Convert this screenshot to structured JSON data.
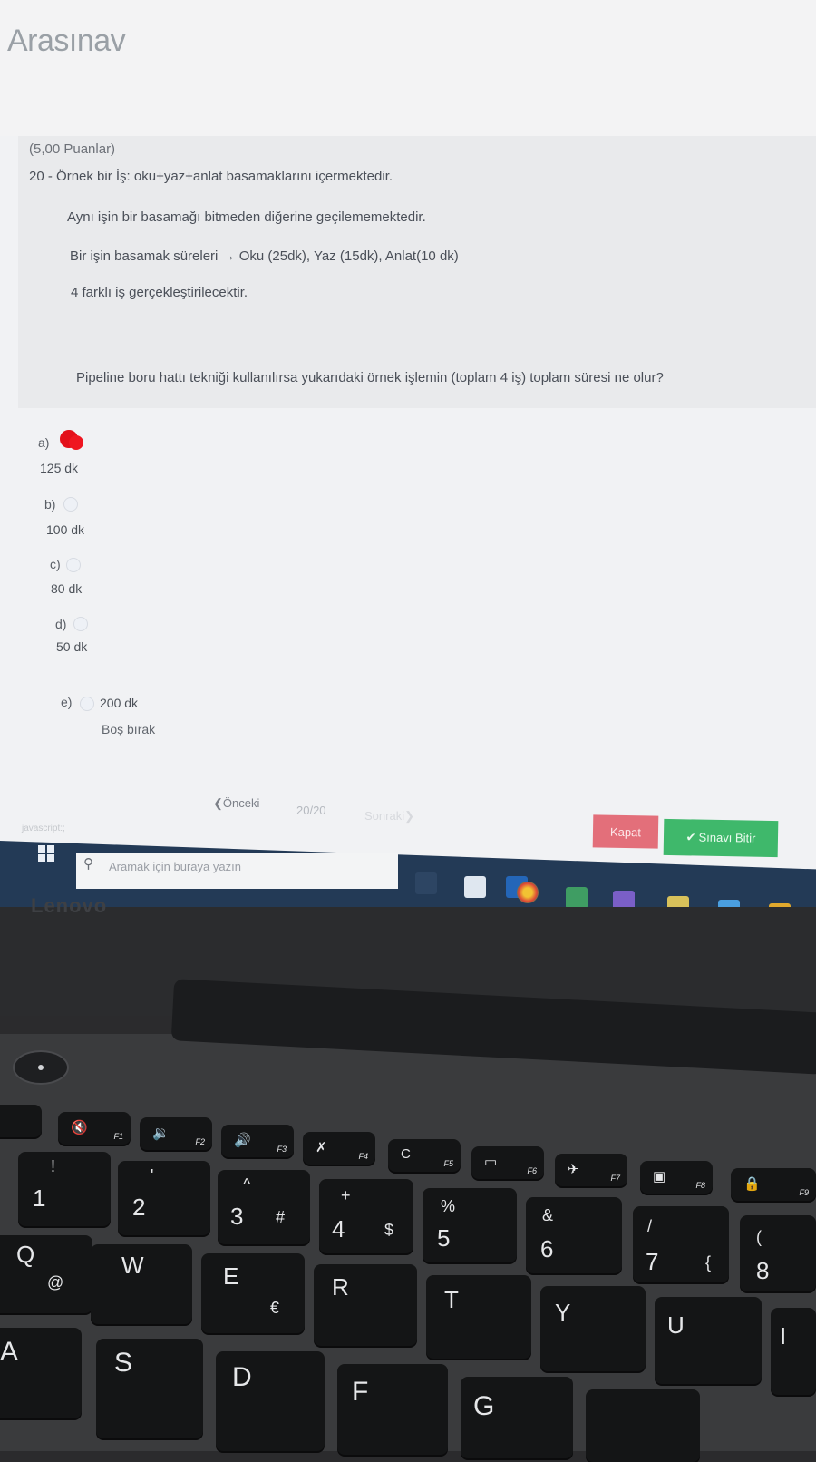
{
  "app": {
    "title": "Arasınav"
  },
  "question": {
    "points": "(5,00 Puanlar)",
    "number": "20 -",
    "headline": "Örnek bir İş: oku+yaz+anlat basamaklarını içermektedir.",
    "lines": [
      "Aynı işin bir basamağı bitmeden diğerine geçilememektedir.",
      "Bir işin basamak süreleri → Oku (25dk), Yaz (15dk),  Anlat(10 dk)",
      "4 farklı iş gerçekleştirilecektir."
    ],
    "prompt": "Pipeline boru hattı tekniği kullanılırsa yukarıdaki örnek işlemin (toplam 4 iş) toplam süresi ne olur?"
  },
  "options": [
    {
      "letter": "a)",
      "value": "125 dk",
      "selected": true
    },
    {
      "letter": "b)",
      "value": "100 dk",
      "selected": false
    },
    {
      "letter": "c)",
      "value": "80 dk",
      "selected": false
    },
    {
      "letter": "d)",
      "value": "50 dk",
      "selected": false
    },
    {
      "letter": "e)",
      "value": "200 dk",
      "selected": false
    }
  ],
  "skip_label": "Boş bırak",
  "nav": {
    "prev": "❮Önceki",
    "page": "20/20",
    "next": "Sonraki❯"
  },
  "status_text": "javascript:;",
  "buttons": {
    "close": "Kapat",
    "finish": "Sınavı Bitir",
    "finish_icon": "✔"
  },
  "taskbar": {
    "search_placeholder": "Aramak için buraya yazın",
    "start_icon": "windows-logo-icon",
    "search_icon": "search-icon"
  },
  "brand": {
    "laptop": "Lenovo"
  },
  "colors": {
    "selected_radio": "#e3101a",
    "close_button": "#e36f7a",
    "finish_button": "#3fb86b",
    "taskbar": "#233a56"
  },
  "keyboard": {
    "fn_row": [
      {
        "fn": "F1",
        "icon": "🔇"
      },
      {
        "fn": "F2",
        "icon": "🔉"
      },
      {
        "fn": "F3",
        "icon": "🔊"
      },
      {
        "fn": "F4",
        "icon": "✗"
      },
      {
        "fn": "F5",
        "icon": "C"
      },
      {
        "fn": "F6",
        "icon": "▭"
      },
      {
        "fn": "F7",
        "icon": "✈"
      },
      {
        "fn": "F8",
        "icon": "▣"
      },
      {
        "fn": "F9",
        "icon": "🔒"
      }
    ],
    "number_row": [
      {
        "main": "1",
        "sub": "!"
      },
      {
        "main": "2",
        "sub": "'"
      },
      {
        "main": "3",
        "sub": "^",
        "alt": "#"
      },
      {
        "main": "4",
        "sub": "+",
        "alt": "$"
      },
      {
        "main": "5",
        "sub": "%"
      },
      {
        "main": "6",
        "sub": "&"
      },
      {
        "main": "7",
        "sub": "/",
        "alt": "{"
      },
      {
        "main": "8",
        "sub": "("
      }
    ],
    "q_row": [
      {
        "main": "Q",
        "sub": "@"
      },
      {
        "main": "W"
      },
      {
        "main": "E",
        "sub": "€"
      },
      {
        "main": "R"
      },
      {
        "main": "T"
      },
      {
        "main": "Y"
      },
      {
        "main": "U"
      },
      {
        "main": "I"
      }
    ],
    "a_row": [
      {
        "main": "A"
      },
      {
        "main": "S"
      },
      {
        "main": "D"
      },
      {
        "main": "F"
      },
      {
        "main": "G"
      }
    ]
  }
}
